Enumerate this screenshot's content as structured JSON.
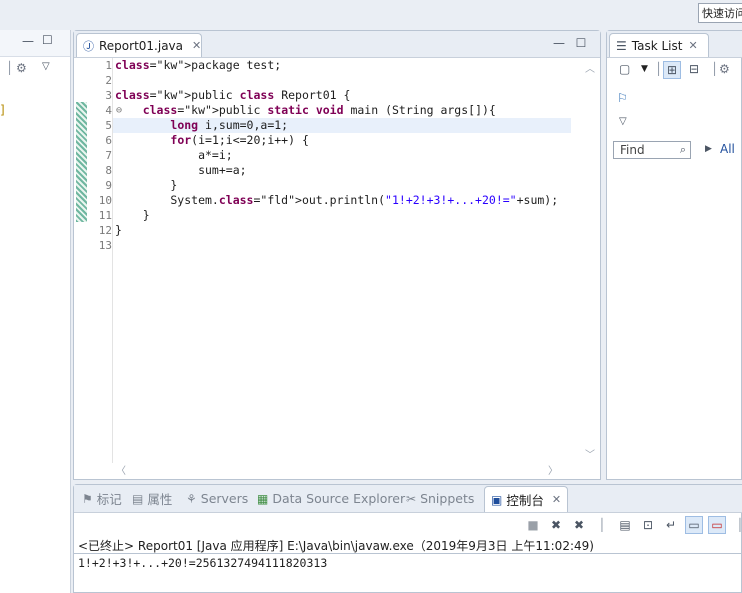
{
  "quick_access": {
    "label": "快速访问"
  },
  "editor": {
    "tab_label": "Report01.java",
    "line_numbers": [
      "1",
      "2",
      "3",
      "4",
      "5",
      "6",
      "7",
      "8",
      "9",
      "10",
      "11",
      "12",
      "13"
    ],
    "code_lines": [
      "package test;",
      "",
      "public class Report01 {",
      "    public static void main (String args[]){",
      "        long i,sum=0,a=1;",
      "        for(i=1;i<=20;i++) {",
      "            a*=i;",
      "            sum+=a;",
      "        }",
      "        System.out.println(\"1!+2!+3!+...+20!=\"+sum);",
      "    }",
      "}",
      ""
    ]
  },
  "tasklist": {
    "tab_label": "Task List",
    "find_placeholder": "Find",
    "all_label": "All"
  },
  "bottom_panel": {
    "tabs": [
      {
        "label": "标记",
        "icon": "markers-icon"
      },
      {
        "label": "属性",
        "icon": "properties-icon"
      },
      {
        "label": "Servers",
        "icon": "servers-icon"
      },
      {
        "label": "Data Source Explorer",
        "icon": "data-source-icon"
      },
      {
        "label": "Snippets",
        "icon": "snippets-icon"
      },
      {
        "label": "控制台",
        "icon": "console-icon"
      }
    ],
    "console_header": "<已终止> Report01 [Java 应用程序] E:\\Java\\bin\\javaw.exe（2019年9月3日 上午11:02:49)",
    "console_output": "1!+2!+3!+...+20!=2561327494111820313"
  }
}
